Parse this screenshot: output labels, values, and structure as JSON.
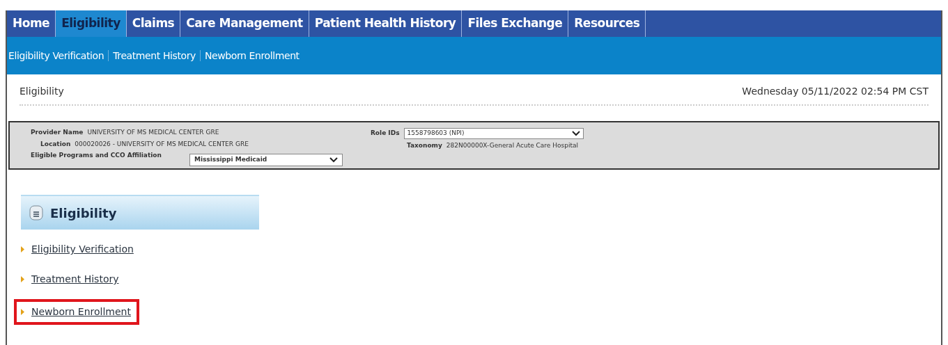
{
  "main_nav": [
    {
      "label": "Home",
      "selected": false
    },
    {
      "label": "Eligibility",
      "selected": true
    },
    {
      "label": "Claims",
      "selected": false
    },
    {
      "label": "Care Management",
      "selected": false
    },
    {
      "label": "Patient Health History",
      "selected": false
    },
    {
      "label": "Files Exchange",
      "selected": false
    },
    {
      "label": "Resources",
      "selected": false
    }
  ],
  "sub_nav": [
    "Eligibility Verification",
    "Treatment History",
    "Newborn Enrollment"
  ],
  "page_title": "Eligibility",
  "datetime": "Wednesday 05/11/2022 02:54 PM CST",
  "provider": {
    "provider_name_label": "Provider Name",
    "provider_name": "UNIVERSITY OF MS MEDICAL CENTER GRE",
    "location_label": "Location",
    "location": "000020026 - UNIVERSITY OF MS MEDICAL CENTER GRE",
    "programs_label": "Eligible Programs and CCO Affiliation",
    "programs_value": "Mississippi Medicaid",
    "role_ids_label": "Role IDs",
    "role_ids_value": "1558798603 (NPI)",
    "taxonomy_label": "Taxonomy",
    "taxonomy": "282N00000X-General Acute Care Hospital"
  },
  "panel": {
    "title": "Eligibility",
    "links": [
      {
        "label": "Eligibility Verification",
        "highlighted": false
      },
      {
        "label": "Treatment History",
        "highlighted": false
      },
      {
        "label": "Newborn Enrollment",
        "highlighted": true
      }
    ]
  }
}
